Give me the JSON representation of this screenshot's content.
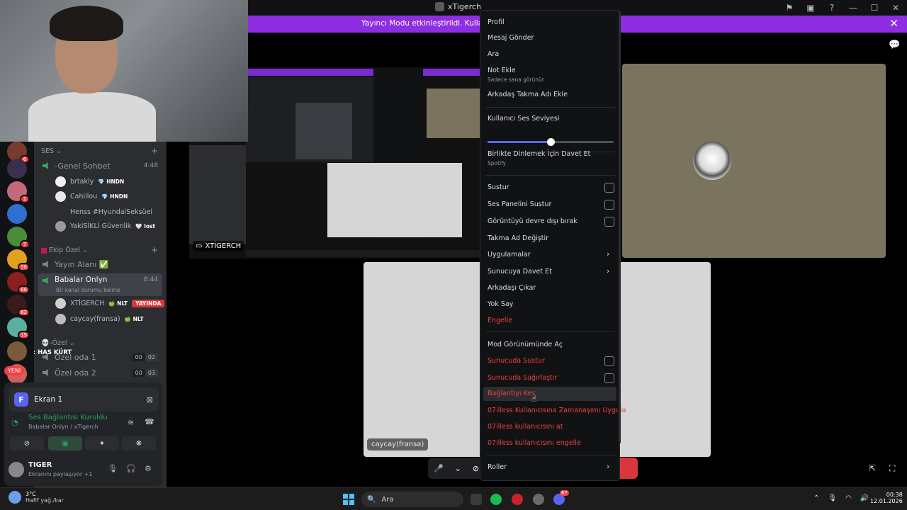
{
  "window": {
    "title": "xTigerch"
  },
  "banner": {
    "text": "Yayıncı Modu etkinleştirildi. Kullanıcı adla"
  },
  "rail": {
    "badges": [
      "6",
      "1",
      "7",
      "56",
      "66",
      "82",
      "19"
    ],
    "new_label": "YENİ"
  },
  "overlay_text": "C/ Mers : HAS KÜRT",
  "sidebar": {
    "voice_category": "SES",
    "channels": {
      "genel": {
        "label": "-Genel Sohbet",
        "time": "4:48"
      },
      "yayin": {
        "label": "Yayın Alanı ✅"
      },
      "babalar": {
        "label": "Babalar Onlyn",
        "time": "8:44",
        "status": "Bir kanal durumu belirle"
      },
      "ozel1": {
        "label": "Özel oda 1",
        "c1": "00",
        "c2": "02"
      },
      "ozel2": {
        "label": "Özel oda 2",
        "c1": "00",
        "c2": "03"
      }
    },
    "genel_members": [
      {
        "name": "brtakly",
        "tag": "💎 HNDN"
      },
      {
        "name": "Cahillou",
        "tag": "💎 HNDN"
      },
      {
        "name": "Henss #HyundaiSeksüel",
        "tag": ""
      },
      {
        "name": "YakiSİKLİ Güvenlik",
        "tag": "🤍 lost"
      }
    ],
    "ekip_category": "Ekip Özel",
    "babalar_members": [
      {
        "name": "XTİGERCH",
        "tag": "🍏 NLT",
        "live": "YAYINDA"
      },
      {
        "name": "caycay(fransa)",
        "tag": "🍏 NLT",
        "live": ""
      }
    ],
    "ozel_category": "💀-Özel"
  },
  "panel": {
    "stream_icon_letter": "F",
    "stream_title": "Ekran 1",
    "voice_status": "Ses Bağlantısı Kuruldu",
    "voice_sub": "Babalar Onlyn / xTigerch",
    "username": "TIGER",
    "user_status": "Ekranını paylaşıyor +1"
  },
  "stage": {
    "stream_label": "XTİGERCH",
    "caycay_label": "caycay(fransa)"
  },
  "menu": {
    "items": {
      "profil": "Profil",
      "mesaj": "Mesaj Gönder",
      "ara": "Ara",
      "not_ekle": "Not Ekle",
      "not_sub": "Sadece sana görünür",
      "takma_ad_ekle": "Arkadaş Takma Adı Ekle",
      "ses_seviyesi": "Kullanıcı Ses Seviyesi",
      "dinle": "Birlikte Dinlemek İçin Davet Et",
      "dinle_sub": "Spotify",
      "sustur": "Sustur",
      "ses_paneli": "Ses Panelini Sustur",
      "goruntu": "Görüntüyü devre dışı bırak",
      "takma_degistir": "Takma Ad Değiştir",
      "uygulamalar": "Uygulamalar",
      "sunucuya_davet": "Sunucuya Davet Et",
      "arkadasi_cikar": "Arkadaşı Çıkar",
      "yok_say": "Yok Say",
      "engelle": "Engelle",
      "mod": "Mod Görünümünde Aç",
      "sunucuda_sustur": "Sunucuda Sustur",
      "sunucuda_sagir": "Sunucuda Sağırlaştır",
      "baglanti_kes": "Bağlantıyı Kes",
      "zaman_asimi": "07illess Kullanıcısına Zamanaşımı Uygula",
      "at": "07illess kullanıcısını at",
      "engelle2": "07illess kullanıcısını engelle",
      "roller": "Roller"
    },
    "volume_fraction": 0.5
  },
  "taskbar": {
    "temp": "3°C",
    "weather_desc": "Hafif yağ./kar",
    "search_placeholder": "Ara",
    "time": "00:38",
    "date": "12.01.2026",
    "discord_badge": "67"
  },
  "colors": {
    "accent": "#5865f2",
    "banner": "#8e2de2",
    "danger": "#f23f43",
    "online": "#23a55a"
  }
}
